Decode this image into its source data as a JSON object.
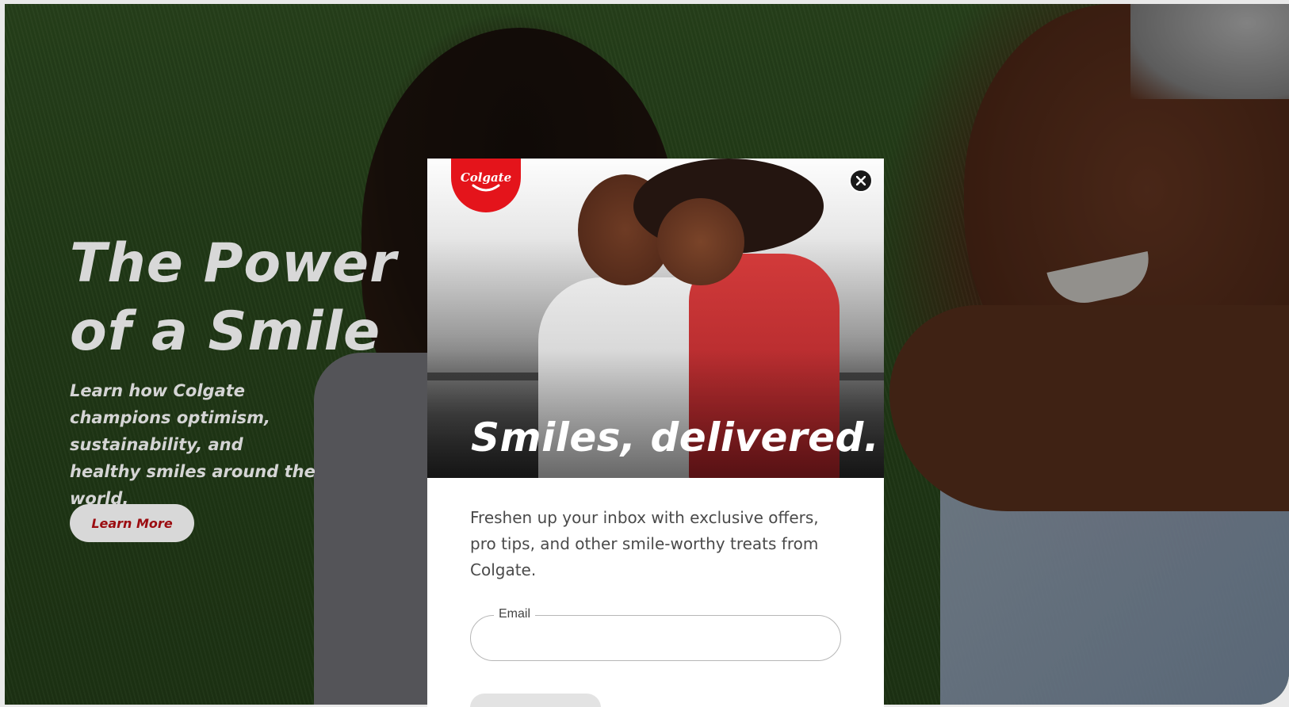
{
  "hero": {
    "title_line1": "The Power",
    "title_line2": "of a Smile",
    "subtitle": "Learn how Colgate champions optimism, sustainability, and healthy smiles around the world.",
    "cta_label": "Learn More"
  },
  "modal": {
    "logo_text": "Colgate",
    "close_icon": "close-icon",
    "headline": "Smiles, delivered.",
    "copy": "Freshen up your inbox with exclusive offers, pro tips, and other smile-worthy treats from Colgate.",
    "email_label": "Email",
    "email_value": ""
  },
  "colors": {
    "brand_red": "#e4141b",
    "cta_text": "#9b0c10",
    "overlay": "rgba(0,0,0,0.40)"
  }
}
